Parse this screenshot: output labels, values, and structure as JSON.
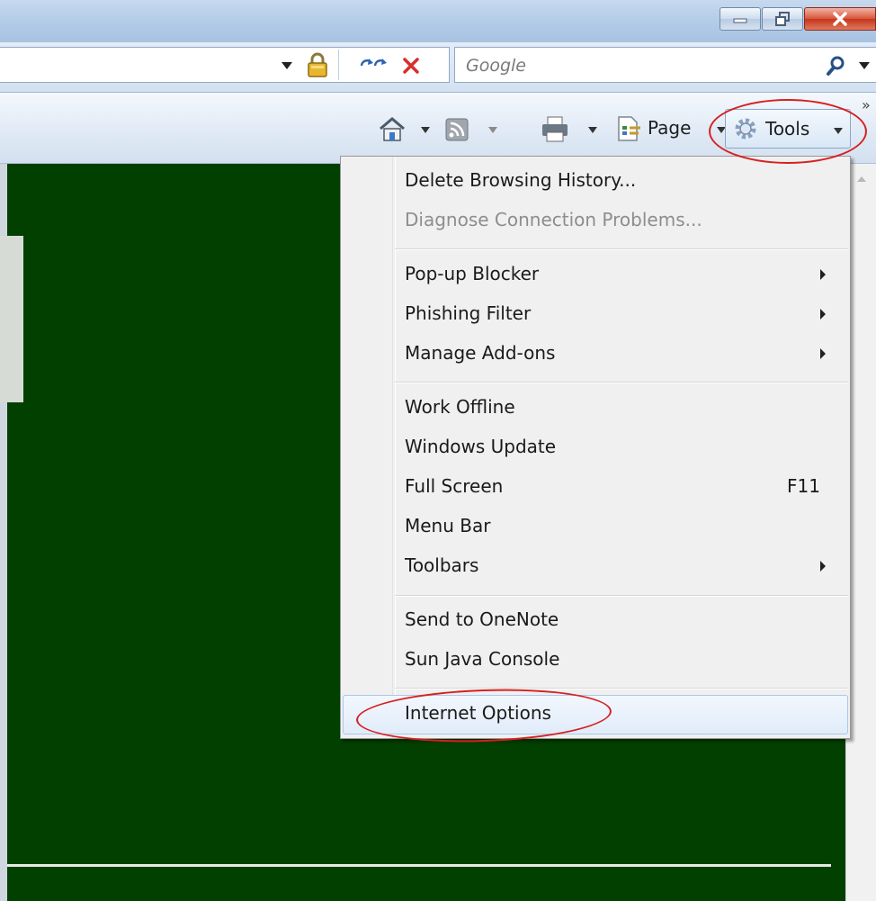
{
  "window": {
    "controls": {
      "minimize_icon": "minimize-icon",
      "restore_icon": "restore-icon",
      "close_icon": "close-icon"
    }
  },
  "address_bar": {
    "icons": [
      "dropdown-arrow-icon",
      "lock-icon",
      "refresh-icon",
      "stop-icon"
    ]
  },
  "search": {
    "placeholder": "Google",
    "icons": [
      "search-icon",
      "dropdown-arrow-icon"
    ]
  },
  "command_bar": {
    "home_icon": "home-icon",
    "feeds_icon": "feeds-icon",
    "print_icon": "print-icon",
    "page_label": "Page",
    "page_icon": "page-icon",
    "tools_label": "Tools",
    "tools_icon": "gear-icon",
    "chevron": "»"
  },
  "tools_menu": {
    "items": [
      {
        "label": "Delete Browsing History...",
        "enabled": true
      },
      {
        "label": "Diagnose Connection Problems...",
        "enabled": false
      },
      {
        "label": "Pop-up Blocker",
        "submenu": true
      },
      {
        "label": "Phishing Filter",
        "submenu": true
      },
      {
        "label": "Manage Add-ons",
        "submenu": true
      },
      {
        "label": "Work Offline"
      },
      {
        "label": "Windows Update"
      },
      {
        "label": "Full Screen",
        "shortcut": "F11"
      },
      {
        "label": "Menu Bar"
      },
      {
        "label": "Toolbars",
        "submenu": true
      },
      {
        "label": "Send to OneNote"
      },
      {
        "label": "Sun Java Console"
      },
      {
        "label": "Internet Options",
        "highlighted": true
      }
    ]
  },
  "colors": {
    "content_background": "#024000",
    "annotation": "#d62020",
    "menu_background": "#f0f0f0"
  }
}
